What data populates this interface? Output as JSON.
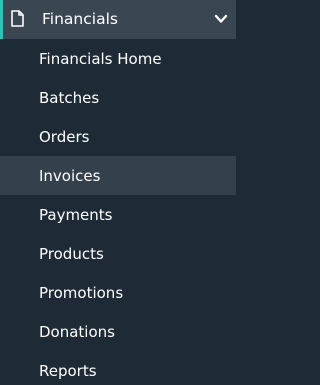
{
  "sidebar": {
    "section": {
      "title": "Financials",
      "icon": "document-icon",
      "expand_icon": "chevron-down-icon",
      "accent_color": "#2ec4b6"
    },
    "items": [
      {
        "label": "Financials Home",
        "active": false
      },
      {
        "label": "Batches",
        "active": false
      },
      {
        "label": "Orders",
        "active": false
      },
      {
        "label": "Invoices",
        "active": true
      },
      {
        "label": "Payments",
        "active": false
      },
      {
        "label": "Products",
        "active": false
      },
      {
        "label": "Promotions",
        "active": false
      },
      {
        "label": "Donations",
        "active": false
      },
      {
        "label": "Reports",
        "active": false
      }
    ]
  }
}
